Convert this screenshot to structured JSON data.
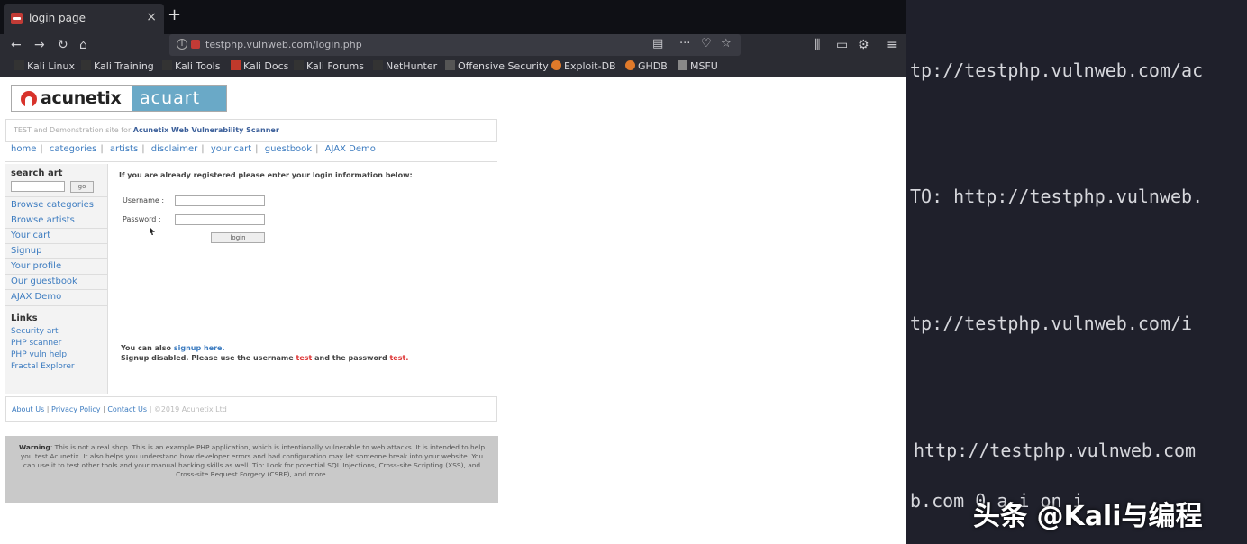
{
  "browser": {
    "tab_title": "login page",
    "tab_close": "×",
    "new_tab": "+",
    "url": "testphp.vulnweb.com/login.php",
    "nav": {
      "back": "←",
      "forward": "→",
      "reload": "↻",
      "home": "⌂"
    },
    "url_icons": {
      "reader": "▤",
      "more": "···",
      "pocket": "♡",
      "star": "☆"
    },
    "toolbar_icons": {
      "library": "⫼",
      "sidebar": "▭",
      "extension": "⚙",
      "menu": "≡"
    },
    "bookmarks": [
      {
        "label": "Kali Linux",
        "color": "#333333"
      },
      {
        "label": "Kali Training",
        "color": "#333333"
      },
      {
        "label": "Kali Tools",
        "color": "#333333"
      },
      {
        "label": "Kali Docs",
        "color": "#c0392b"
      },
      {
        "label": "Kali Forums",
        "color": "#333333"
      },
      {
        "label": "NetHunter",
        "color": "#333333"
      },
      {
        "label": "Offensive Security",
        "color": "#555555"
      },
      {
        "label": "Exploit-DB",
        "color": "#e07a2a"
      },
      {
        "label": "GHDB",
        "color": "#e07a2a"
      },
      {
        "label": "MSFU",
        "color": "#888888"
      }
    ]
  },
  "site": {
    "logo_left": "acunetix",
    "logo_right": "acuart",
    "tagline_prefix": "TEST and Demonstration site for",
    "tagline_brand": "Acunetix Web Vulnerability Scanner",
    "topnav": [
      "home",
      "categories",
      "artists",
      "disclaimer",
      "your cart",
      "guestbook",
      "AJAX Demo"
    ],
    "sidebar": {
      "search_heading": "search art",
      "go_label": "go",
      "links": [
        "Browse categories",
        "Browse artists",
        "Your cart",
        "Signup",
        "Your profile",
        "Our guestbook",
        "AJAX Demo"
      ],
      "links_heading": "Links",
      "small_links": [
        "Security art",
        "PHP scanner",
        "PHP vuln help",
        "Fractal Explorer"
      ]
    },
    "login": {
      "intro": "If you are already registered please enter your login information below:",
      "username_label": "Username :",
      "password_label": "Password :",
      "login_button": "login",
      "signup_prefix": "You can also",
      "signup_link": "signup here.",
      "disabled_prefix": "Signup disabled. Please use the username",
      "user_value": "test",
      "disabled_middle": "and the password",
      "pass_value": "test."
    },
    "footer": {
      "about": "About Us",
      "privacy": "Privacy Policy",
      "contact": "Contact Us",
      "sep": "|",
      "copyright": "©2019 Acunetix Ltd"
    },
    "warning": {
      "label": "Warning",
      "text": ": This is not a real shop. This is an example PHP application, which is intentionally vulnerable to web attacks. It is intended to help you test Acunetix. It also helps you understand how developer errors and bad configuration may let someone break into your website. You can use it to test other tools and your manual hacking skills as well. Tip: Look for potential SQL Injections, Cross-site Scripting (XSS), and Cross-site Request Forgery (CSRF), and more."
    }
  },
  "terminal": {
    "lines": [
      "tp://testphp.vulnweb.com/ac",
      "TO: http://testphp.vulnweb.",
      "tp://testphp.vulnweb.com/i",
      " http://testphp.vulnweb.com",
      "b.com 0  a i on  i "
    ]
  },
  "watermark": "头条 @Kali与编程"
}
